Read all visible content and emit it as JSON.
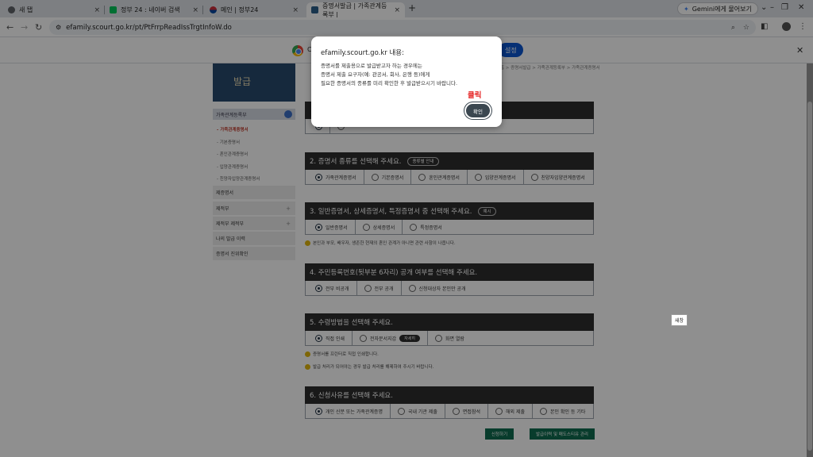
{
  "browser": {
    "tabs": [
      {
        "label": "새 탭"
      },
      {
        "label": "정부 24 : 네이버 검색"
      },
      {
        "label": "메인 | 정부24"
      },
      {
        "label": "증명서발급 | 가족관계등록부 |"
      }
    ],
    "new_tab": "+",
    "gemini_label": "Gemini에게 물어보기",
    "url": "efamily.scourt.go.kr/pt/PtFrrpReadIssTrgtInfoW.do",
    "infobar_prefix": "C",
    "infobar_button": "설정"
  },
  "sidebar": {
    "banner": "발급",
    "head": "가족관계등록부",
    "sub_items": [
      "- 가족관계증명서",
      "- 기본증명서",
      "- 혼인관계증명서",
      "- 입양관계증명서",
      "- 친양자입양관계증명서"
    ],
    "groups": [
      "제증명서",
      "제적부",
      "제적부 제적부",
      "나의 발급 이력",
      "증명서 진위확인"
    ]
  },
  "main": {
    "breadcrumb": "홈 > 증명서발급 > 가족관계등록부 > 가족관계증명서",
    "sections": [
      {
        "title": "2. 증명서 종류를 선택해 주세요.",
        "pill": "종류별 안내",
        "options": [
          "가족관계증명서",
          "기본증명서",
          "혼인관계증명서",
          "입양관계증명서",
          "친양자입양관계증명서"
        ],
        "selected": 0
      },
      {
        "title": "3. 일반증명서, 상세증명서, 특정증명서 중 선택해 주세요.",
        "pill": "예시",
        "options": [
          "일반증명서",
          "상세증명서",
          "특정증명서"
        ],
        "selected": 0
      },
      {
        "title": "4. 주민등록번호(뒷부분 6자리) 공개 여부를 선택해 주세요.",
        "options": [
          "전부 비공개",
          "전부 공개",
          "신청대상자 본인만 공개"
        ],
        "selected": 0
      },
      {
        "title": "5. 수령방법을 선택해 주세요.",
        "options": [
          "직접 인쇄",
          "전자문서지갑",
          "화면 열람"
        ],
        "selected": 0,
        "detail_pill": "자세히"
      },
      {
        "title": "6. 신청사유를 선택해 주세요.",
        "options": [
          "개인 신분 또는 가족관계증명",
          "국내 기관 제출",
          "면접참석",
          "해외 제출",
          "본인 확인 등 기타"
        ],
        "selected": 0
      }
    ],
    "notes": [
      "본인과 부모, 배우자, 생존한 현재의 혼인 관계가 아니면 관련 사항이 나옵니다.",
      "증명서를 프린터로 직접 인쇄합니다.",
      "발급 처리가 되어야는 경우 발급 처리를 해제하여 주시기 바랍니다."
    ],
    "buttons": [
      "신청하기",
      "발급이력 및 매도스티유 관리"
    ]
  },
  "overlay_tip": "새창",
  "dialog": {
    "title": "efamily.scourt.go.kr 내용:",
    "lines": [
      "증명서를 제출용으로 발급받고자 하는 경우에는",
      "증명서 제출 요구자(예: 관공서, 회사, 은행 등)에게",
      "필요한 증명서의 종류를 미리 확인한 후 발급받으시기 바랍니다."
    ],
    "ok_label": "확인",
    "annotation": "클릭"
  }
}
